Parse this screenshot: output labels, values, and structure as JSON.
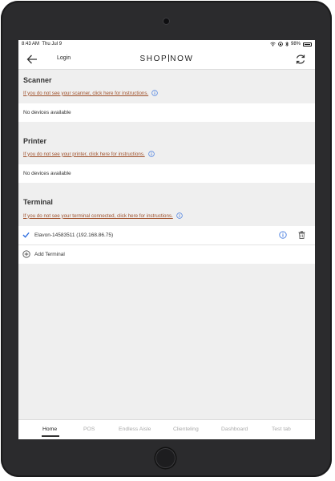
{
  "status_bar": {
    "time": "8:43 AM",
    "date": "Thu Jul 9",
    "battery": "98%"
  },
  "nav": {
    "login_label": "Login",
    "brand_left": "SHOP",
    "brand_right": "NOW"
  },
  "scanner": {
    "title": "Scanner",
    "instructions": "If you do not see your scanner, click here for instructions.",
    "empty_text": "No devices available"
  },
  "printer": {
    "title": "Printer",
    "instructions": "If you do not see your printer, click here for instructions.",
    "empty_text": "No devices available"
  },
  "terminal": {
    "title": "Terminal",
    "instructions": "If you do not see your terminal connected, click here for instructions.",
    "device_label": "Elavon-14583511 (192.168.86.75)",
    "add_label": "Add Terminal"
  },
  "tabs": [
    {
      "label": "Home",
      "active": true
    },
    {
      "label": "POS",
      "active": false
    },
    {
      "label": "Endless Aisle",
      "active": false
    },
    {
      "label": "Clienteling",
      "active": false
    },
    {
      "label": "Dashboard",
      "active": false
    },
    {
      "label": "Test tab",
      "active": false
    }
  ],
  "colors": {
    "link": "#a0522d",
    "info_blue": "#4a7fe0",
    "check_blue": "#2f6fe0",
    "background": "#efefef"
  }
}
